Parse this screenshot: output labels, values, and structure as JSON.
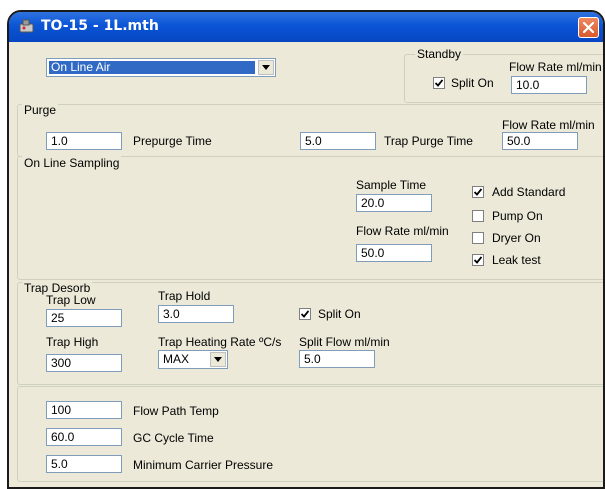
{
  "window": {
    "title": "TO-15 - 1L.mth"
  },
  "mode_select": {
    "value": "On Line Air"
  },
  "standby": {
    "legend": "Standby",
    "split_on_label": "Split On",
    "split_on_checked": true,
    "flow_rate_label": "Flow Rate ml/min",
    "flow_rate_value": "10.0"
  },
  "purge": {
    "legend": "Purge",
    "prepurge_value": "1.0",
    "prepurge_label": "Prepurge Time",
    "trap_purge_value": "5.0",
    "trap_purge_label": "Trap Purge Time",
    "flow_rate_label": "Flow Rate ml/min",
    "flow_rate_value": "50.0"
  },
  "online_sampling": {
    "legend": "On Line Sampling",
    "sample_time_label": "Sample Time",
    "sample_time_value": "20.0",
    "flow_rate_label": "Flow Rate ml/min",
    "flow_rate_value": "50.0",
    "checkboxes": [
      {
        "label": "Add Standard",
        "checked": true
      },
      {
        "label": "Pump On",
        "checked": false
      },
      {
        "label": "Dryer On",
        "checked": false
      },
      {
        "label": "Leak test",
        "checked": true
      }
    ]
  },
  "trap_desorb": {
    "legend": "Trap Desorb",
    "trap_low_label": "Trap Low",
    "trap_low_value": "25",
    "trap_hold_label": "Trap Hold",
    "trap_hold_value": "3.0",
    "split_on_label": "Split On",
    "split_on_checked": true,
    "trap_high_label": "Trap High",
    "trap_high_value": "300",
    "heating_rate_label": "Trap Heating Rate ºC/s",
    "heating_rate_value": "MAX",
    "split_flow_label": "Split Flow ml/min",
    "split_flow_value": "5.0"
  },
  "misc": {
    "flow_path_temp_value": "100",
    "flow_path_temp_label": "Flow Path Temp",
    "gc_cycle_value": "60.0",
    "gc_cycle_label": "GC Cycle Time",
    "min_carrier_value": "5.0",
    "min_carrier_label": "Minimum Carrier Pressure"
  },
  "icons": {
    "app": "gc-instrument-icon",
    "close": "close-icon",
    "check": "checkmark-icon",
    "dropdown": "chevron-down-icon"
  },
  "colors": {
    "title_bar": "#0a55d6",
    "close_button": "#e06a3c",
    "panel": "#ece9d8",
    "selection": "#316ac5"
  }
}
